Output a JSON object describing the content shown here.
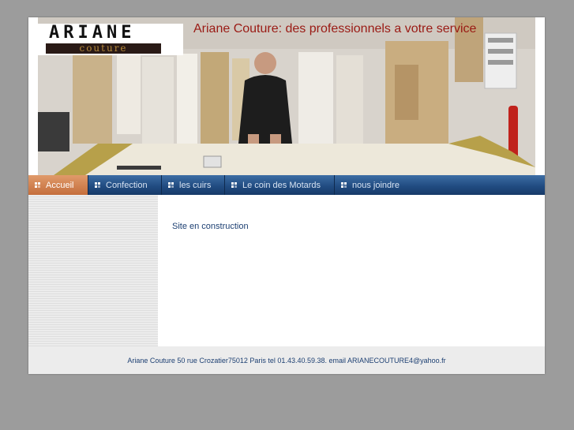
{
  "header": {
    "logo_top": "ARIANE",
    "logo_bottom": "couture",
    "slogan": "Ariane Couture: des professionnels a votre service"
  },
  "nav": {
    "items": [
      {
        "label": "Accueil",
        "active": true
      },
      {
        "label": "Confection",
        "active": false
      },
      {
        "label": "les cuirs",
        "active": false
      },
      {
        "label": "Le coin des Motards",
        "active": false
      },
      {
        "label": "nous joindre",
        "active": false
      }
    ]
  },
  "main": {
    "text": "Site en construction"
  },
  "footer": {
    "text": "Ariane Couture 50 rue Crozatier75012 Paris tel 01.43.40.59.38. email ARIANECOUTURE4@yahoo.fr"
  },
  "colors": {
    "nav_bg": "#214c82",
    "nav_active": "#d3845a",
    "slogan": "#9a1a14",
    "text": "#1c3f72"
  }
}
